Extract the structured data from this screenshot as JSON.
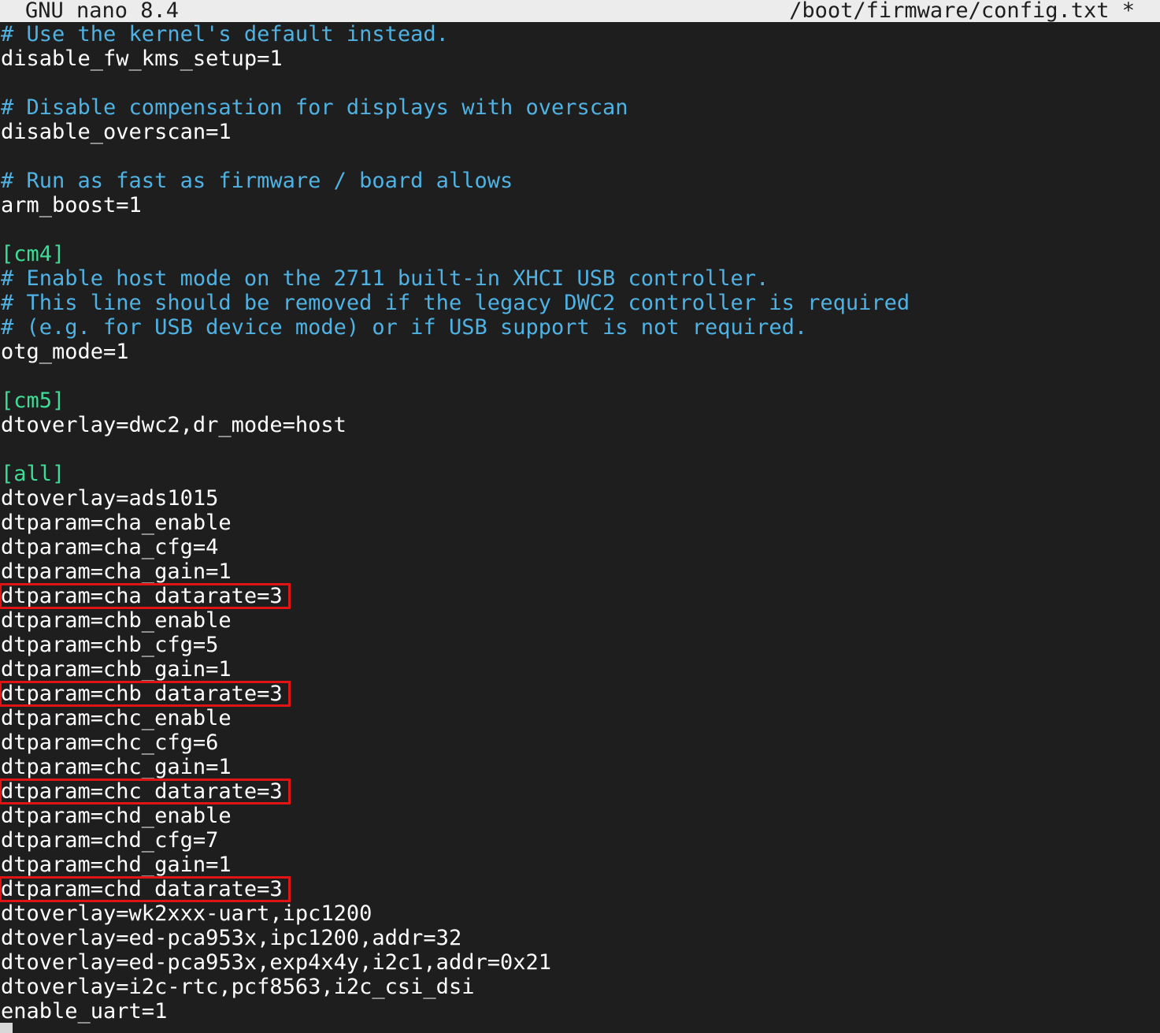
{
  "titlebar": {
    "app": "GNU nano 8.4",
    "file": "/boot/firmware/config.txt *"
  },
  "colors": {
    "background": "#1e1e1e",
    "comment": "#4fb2e3",
    "section": "#3ddc97",
    "text": "#ffffff",
    "highlight": "#e01414",
    "titlebar_bg": "#ececec"
  },
  "lines": [
    {
      "text": "# Use the kernel's default instead.",
      "kind": "comment"
    },
    {
      "text": "disable_fw_kms_setup=1",
      "kind": "plain"
    },
    {
      "text": "",
      "kind": "plain"
    },
    {
      "text": "# Disable compensation for displays with overscan",
      "kind": "comment"
    },
    {
      "text": "disable_overscan=1",
      "kind": "plain"
    },
    {
      "text": "",
      "kind": "plain"
    },
    {
      "text": "# Run as fast as firmware / board allows",
      "kind": "comment"
    },
    {
      "text": "arm_boost=1",
      "kind": "plain"
    },
    {
      "text": "",
      "kind": "plain"
    },
    {
      "text": "[cm4]",
      "kind": "section"
    },
    {
      "text": "# Enable host mode on the 2711 built-in XHCI USB controller.",
      "kind": "comment"
    },
    {
      "text": "# This line should be removed if the legacy DWC2 controller is required",
      "kind": "comment"
    },
    {
      "text": "# (e.g. for USB device mode) or if USB support is not required.",
      "kind": "comment"
    },
    {
      "text": "otg_mode=1",
      "kind": "plain"
    },
    {
      "text": "",
      "kind": "plain"
    },
    {
      "text": "[cm5]",
      "kind": "section"
    },
    {
      "text": "dtoverlay=dwc2,dr_mode=host",
      "kind": "plain"
    },
    {
      "text": "",
      "kind": "plain"
    },
    {
      "text": "[all]",
      "kind": "section"
    },
    {
      "text": "dtoverlay=ads1015",
      "kind": "plain"
    },
    {
      "text": "dtparam=cha_enable",
      "kind": "plain"
    },
    {
      "text": "dtparam=cha_cfg=4",
      "kind": "plain"
    },
    {
      "text": "dtparam=cha_gain=1",
      "kind": "plain"
    },
    {
      "text": "dtparam=cha_datarate=3",
      "kind": "plain",
      "highlighted": true
    },
    {
      "text": "dtparam=chb_enable",
      "kind": "plain"
    },
    {
      "text": "dtparam=chb_cfg=5",
      "kind": "plain"
    },
    {
      "text": "dtparam=chb_gain=1",
      "kind": "plain"
    },
    {
      "text": "dtparam=chb_datarate=3",
      "kind": "plain",
      "highlighted": true
    },
    {
      "text": "dtparam=chc_enable",
      "kind": "plain"
    },
    {
      "text": "dtparam=chc_cfg=6",
      "kind": "plain"
    },
    {
      "text": "dtparam=chc_gain=1",
      "kind": "plain"
    },
    {
      "text": "dtparam=chc_datarate=3",
      "kind": "plain",
      "highlighted": true
    },
    {
      "text": "dtparam=chd_enable",
      "kind": "plain"
    },
    {
      "text": "dtparam=chd_cfg=7",
      "kind": "plain"
    },
    {
      "text": "dtparam=chd_gain=1",
      "kind": "plain"
    },
    {
      "text": "dtparam=chd_datarate=3",
      "kind": "plain",
      "highlighted": true
    },
    {
      "text": "dtoverlay=wk2xxx-uart,ipc1200",
      "kind": "plain"
    },
    {
      "text": "dtoverlay=ed-pca953x,ipc1200,addr=32",
      "kind": "plain"
    },
    {
      "text": "dtoverlay=ed-pca953x,exp4x4y,i2c1,addr=0x21",
      "kind": "plain"
    },
    {
      "text": "dtoverlay=i2c-rtc,pcf8563,i2c_csi_dsi",
      "kind": "plain"
    },
    {
      "text": "enable_uart=1",
      "kind": "plain"
    }
  ]
}
